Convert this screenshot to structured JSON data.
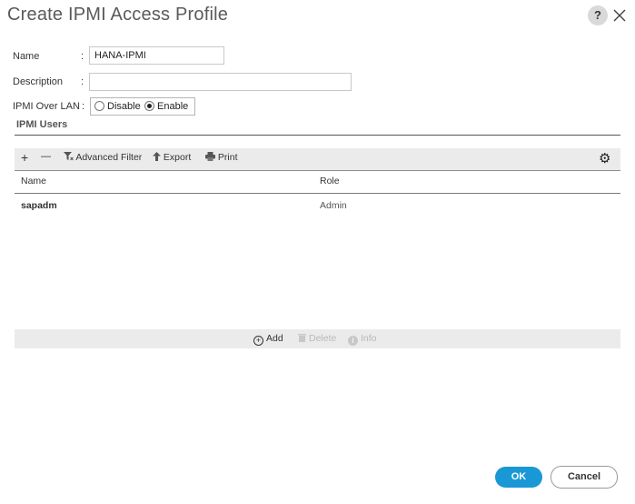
{
  "dialog": {
    "title": "Create IPMI Access Profile",
    "help_label": "?"
  },
  "form": {
    "name_label": "Name",
    "name_value": "HANA-IPMI",
    "description_label": "Description",
    "description_value": "",
    "ipmi_over_lan_label": "IPMI Over LAN",
    "colon": ":",
    "radio_options": [
      "Disable",
      "Enable"
    ],
    "selected_option": "Enable"
  },
  "users_section": {
    "title": "IPMI Users",
    "toolbar": {
      "add_icon": "+",
      "remove_icon": "—",
      "advanced_filter_label": "Advanced Filter",
      "export_label": "Export",
      "print_label": "Print",
      "settings_icon": "gear-icon"
    },
    "columns": [
      "Name",
      "Role"
    ],
    "rows": [
      {
        "name": "sapadm",
        "role": "Admin"
      }
    ],
    "footer": {
      "add_label": "Add",
      "delete_label": "Delete",
      "info_label": "Info"
    }
  },
  "buttons": {
    "ok_label": "OK",
    "cancel_label": "Cancel"
  },
  "colors": {
    "primary": "#1a98d6",
    "toolbar_bg": "#ebebeb",
    "disabled_text": "#b9b9b9"
  }
}
